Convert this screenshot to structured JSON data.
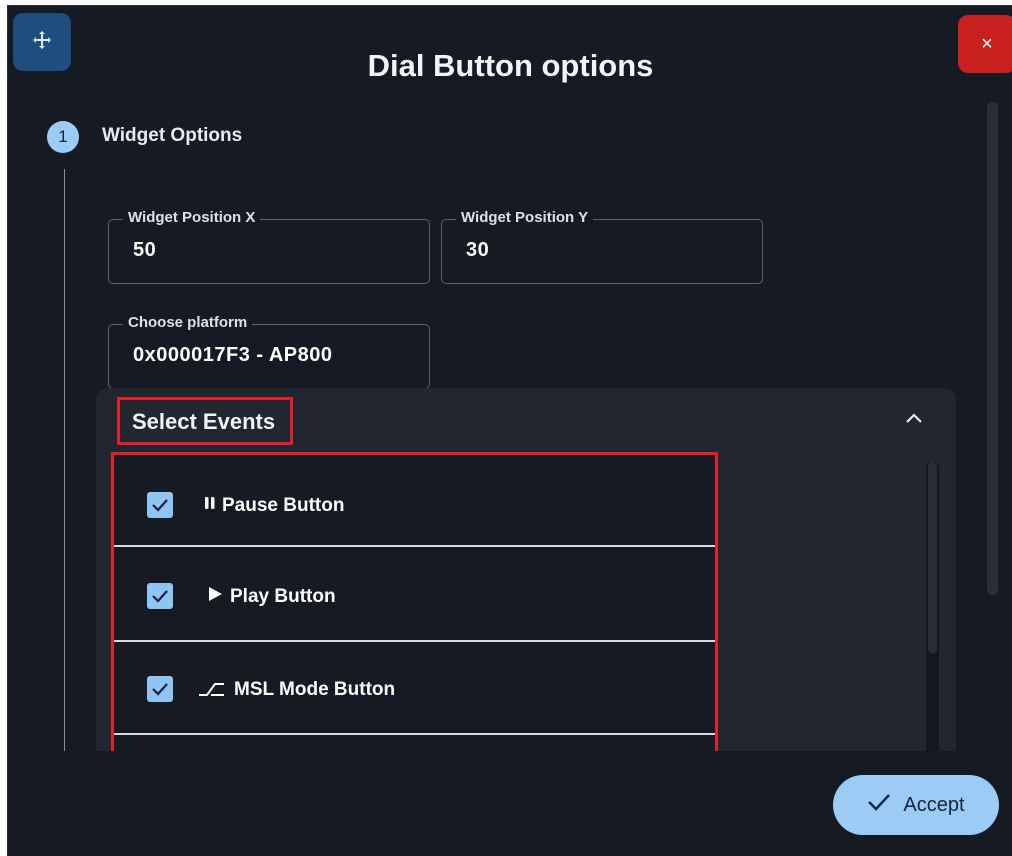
{
  "dialog": {
    "title": "Dial Button options",
    "move_icon": "move-icon",
    "close_icon": "close-icon",
    "close_glyph": "×"
  },
  "step": {
    "number": "1",
    "label": "Widget Options"
  },
  "fields": {
    "position_x": {
      "label": "Widget Position X",
      "value": "50"
    },
    "position_y": {
      "label": "Widget Position Y",
      "value": "30"
    },
    "platform": {
      "label": "Choose platform",
      "value": "0x000017F3 - AP800"
    }
  },
  "events": {
    "title": "Select Events",
    "expanded": true,
    "items": [
      {
        "label": "Pause Button",
        "checked": true,
        "icon": "pause-icon"
      },
      {
        "label": "Play Button",
        "checked": true,
        "icon": "play-icon"
      },
      {
        "label": "MSL Mode Button",
        "checked": true,
        "icon": "msl-mode-icon"
      }
    ]
  },
  "accept": {
    "label": "Accept",
    "icon": "check-icon"
  },
  "colors": {
    "dialog_bg": "#161a22",
    "panel_bg": "#22262e",
    "accent": "#9ccbf5",
    "close_red": "#c8201f",
    "move_blue": "#1d4e7e",
    "highlight_red": "#e3202a"
  }
}
